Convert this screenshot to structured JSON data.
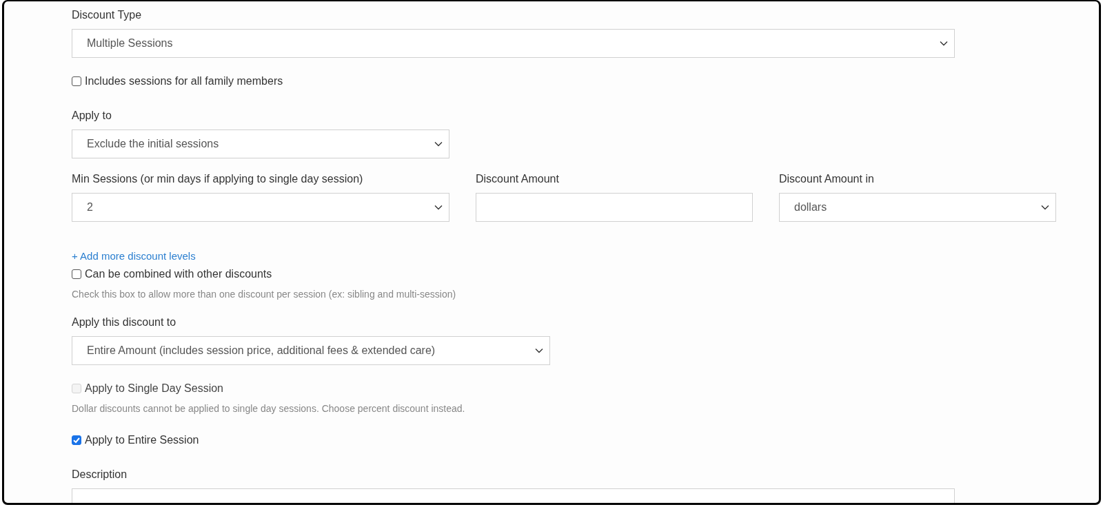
{
  "form": [
    {
      "kind": "select",
      "label": "Discount Type",
      "value": "Multiple Sessions"
    },
    {
      "kind": "checkbox",
      "label": "Includes sessions for all family members",
      "checked": false,
      "disabled": false
    },
    {
      "kind": "select",
      "label": "Apply to",
      "value": "Exclude the initial sessions"
    },
    {
      "kind": "row",
      "fields": [
        {
          "kind": "select",
          "label": "Min Sessions (or min days if applying to single day session)",
          "value": "2"
        },
        {
          "kind": "text",
          "label": "Discount Amount"
        },
        {
          "kind": "select",
          "label": "Discount Amount in",
          "value": "dollars"
        }
      ]
    },
    {
      "kind": "link",
      "label": "+ Add more discount levels"
    },
    {
      "kind": "checkbox",
      "label": "Can be combined with other discounts",
      "checked": false,
      "disabled": false
    },
    {
      "kind": "hint",
      "label": "Check this box to allow more than one discount per session (ex: sibling and multi-session)"
    },
    {
      "kind": "select",
      "label": "Apply this discount to",
      "value": "Entire Amount (includes session price, additional fees & extended care)"
    },
    {
      "kind": "checkbox",
      "label": "Apply to Single Day Session",
      "checked": false,
      "disabled": true
    },
    {
      "kind": "hint",
      "label": "Dollar discounts cannot be applied to single day sessions. Choose percent discount instead."
    },
    {
      "kind": "checkbox",
      "label": "Apply to Entire Session",
      "checked": true,
      "disabled": false
    },
    {
      "kind": "textarea",
      "label": "Description"
    }
  ]
}
